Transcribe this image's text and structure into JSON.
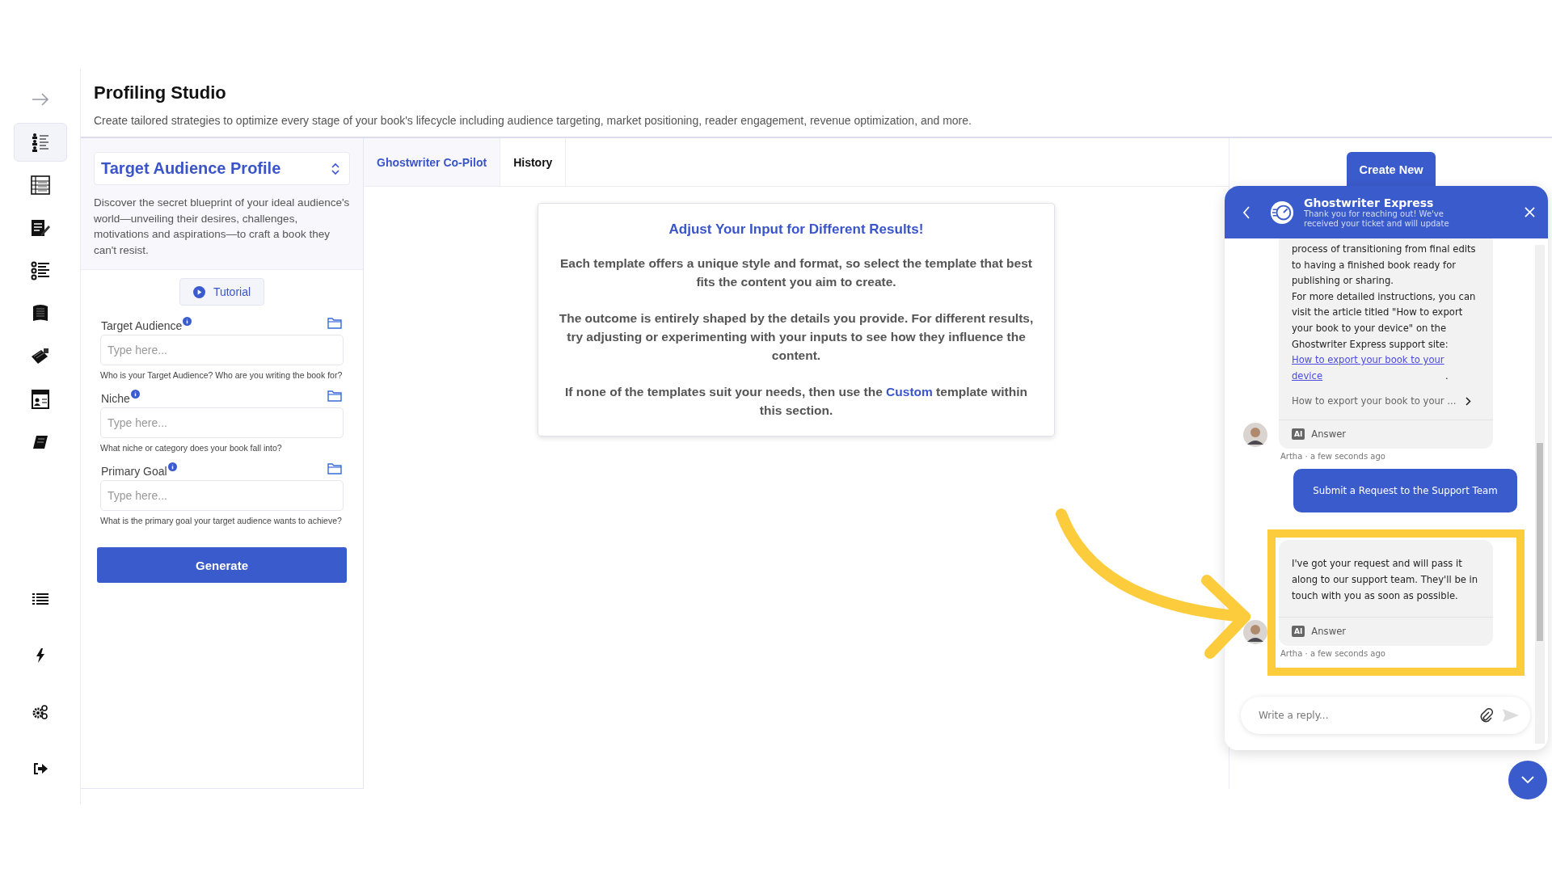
{
  "sidebar": {
    "items": [
      {
        "kind": "expand",
        "selected": false
      },
      {
        "kind": "audience",
        "selected": true
      },
      {
        "kind": "outline",
        "selected": false
      },
      {
        "kind": "edit",
        "selected": false
      },
      {
        "kind": "steps",
        "selected": false
      },
      {
        "kind": "book",
        "selected": false
      },
      {
        "kind": "books",
        "selected": false
      },
      {
        "kind": "profile",
        "selected": false
      },
      {
        "kind": "notebook",
        "selected": false
      }
    ],
    "bottom_items": [
      {
        "kind": "list",
        "selected": false
      },
      {
        "kind": "bolt",
        "selected": false
      },
      {
        "kind": "settings",
        "selected": false
      },
      {
        "kind": "logout",
        "selected": false
      }
    ]
  },
  "header": {
    "title": "Profiling Studio",
    "subtitle": "Create tailored strategies to optimize every stage of your book's lifecycle including audience targeting, market positioning, reader engagement, revenue optimization, and more."
  },
  "tool": {
    "title": "Target Audience Profile",
    "description": "Discover the secret blueprint of your ideal audience's world—unveiling their desires, challenges, motivations and aspirations—to craft a book they can't resist.",
    "tutorial": "Tutorial"
  },
  "fields": [
    {
      "label": "Target Audience",
      "placeholder": "Type here...",
      "hint": "Who is your Target Audience? Who are you writing the book for?"
    },
    {
      "label": "Niche",
      "placeholder": "Type here...",
      "hint": "What niche or category does your book fall into?"
    },
    {
      "label": "Primary Goal",
      "placeholder": "Type here...",
      "hint": "What is the primary goal your target audience wants to achieve?"
    }
  ],
  "generate_button": "Generate",
  "tabs": [
    {
      "label": "Ghostwriter Co-Pilot",
      "selected": true
    },
    {
      "label": "History",
      "selected": false
    }
  ],
  "info_card": {
    "title": "Adjust Your Input for Different Results!",
    "paragraphs": [
      "Each template offers a unique style and format, so select the template that best fits the content you aim to create.",
      "The outcome is entirely shaped by the details you provide. For different results, try adjusting or experimenting with your inputs to see how they influence the content."
    ],
    "last_paragraph": {
      "before": "If none of the templates suit your needs, then use the ",
      "link": "Custom",
      "after": " template within this section."
    }
  },
  "create_new_button": "Create New",
  "chat": {
    "title": "Ghostwriter Express",
    "subtitle": "Thank you for reaching out! We've received your ticket and will update",
    "messages": [
      {
        "kind": "bot",
        "text": "process of transitioning from final edits to having a finished book ready for publishing or sharing.",
        "text2": "For more detailed instructions, you can visit the article titled \"How to export your book to your device\" on the Ghostwriter Express support site:",
        "link": "How to export your book to your device",
        "link_after": ".",
        "article": "How to export your book to your ...",
        "tag": "AI",
        "footer": "Answer",
        "meta": "Artha · a few seconds ago"
      },
      {
        "kind": "user",
        "text": "Submit a Request to the Support Team"
      },
      {
        "kind": "bot",
        "text": "I've got your request and will pass it along to our support team. They'll be in touch with you as soon as possible.",
        "tag": "AI",
        "footer": "Answer",
        "meta": "Artha · a few seconds ago"
      }
    ],
    "reply_placeholder": "Write a reply..."
  }
}
